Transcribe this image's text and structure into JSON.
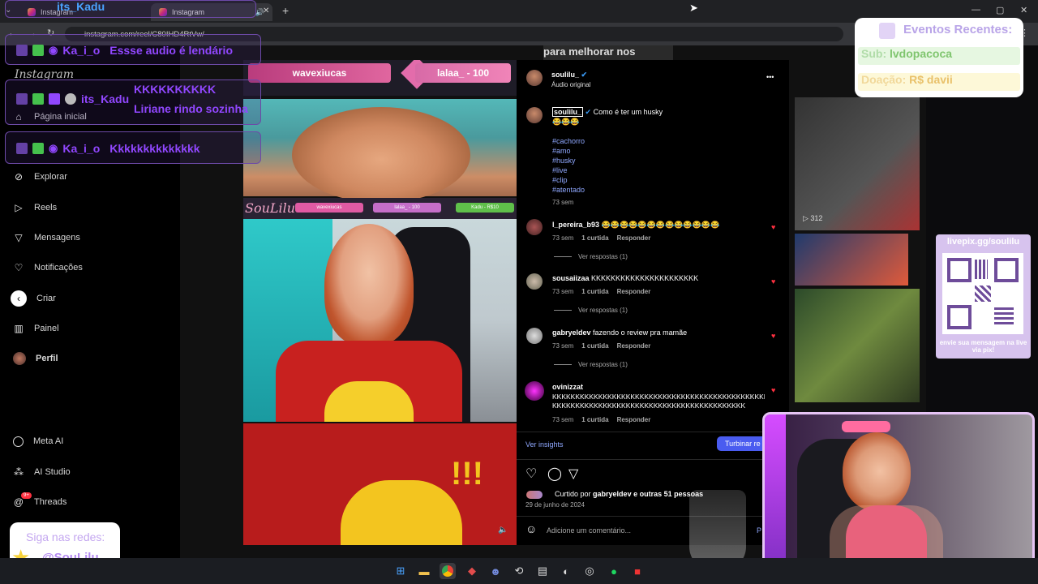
{
  "browser": {
    "tabs": [
      {
        "label": "Instagram"
      },
      {
        "label": "Instagram"
      }
    ],
    "url": "instagram.com/reel/C80IHD4RtVw/",
    "new_tab": "+",
    "window_controls": [
      "—",
      "▢",
      "✕"
    ]
  },
  "sidebar": {
    "logo": "Instagram",
    "items": [
      {
        "label": "Página inicial",
        "icon": "home-icon"
      },
      {
        "label": "Explorar",
        "icon": "compass-icon"
      },
      {
        "label": "Reels",
        "icon": "reels-icon"
      },
      {
        "label": "Mensagens",
        "icon": "send-icon"
      },
      {
        "label": "Notificações",
        "icon": "heart-icon"
      },
      {
        "label": "Criar",
        "icon": "plus-icon"
      },
      {
        "label": "Painel",
        "icon": "chart-icon"
      },
      {
        "label": "Perfil",
        "icon": "avatar"
      },
      {
        "label": "Meta AI",
        "icon": "meta-ai-icon"
      },
      {
        "label": "AI Studio",
        "icon": "ai-studio-icon"
      },
      {
        "label": "Threads",
        "icon": "threads-icon"
      }
    ],
    "threads_badge": "9+"
  },
  "chat_overlay": [
    {
      "user": "its_Kadu",
      "message": ""
    },
    {
      "user": "Ka_i_o",
      "message": "Essse audio é lendário"
    },
    {
      "user": "its_Kadu",
      "message": "KKKKKKKKKK",
      "message2": "Liriane rindo sozinha"
    },
    {
      "user": "Ka_i_o",
      "message": "Kkkkkkkkkkkkkk"
    }
  ],
  "video": {
    "banner_left": "wavexiucas",
    "banner_right": "lalaa_ - 100",
    "bar_logo": "SouLilu",
    "bar_items": [
      "wavexiucas",
      "lalaa_ - 100",
      "Kadu - R$10"
    ]
  },
  "post": {
    "author": "soulilu_",
    "audio": "Áudio original",
    "caption_user": "soulilu_",
    "caption": "Como é ter um husky",
    "caption_emoji": "😂😂😂",
    "hashtags": [
      "#cachorro",
      "#amo",
      "#husky",
      "#live",
      "#clip",
      "#atentado"
    ],
    "caption_time": "73 sem",
    "more": "•••",
    "comments": [
      {
        "user": "l_pereira_b93",
        "text": "😂😂😂😂😂😂😂😂😂😂😂😂😂",
        "time": "73 sem",
        "likes": "1 curtida",
        "reply": "Responder",
        "view_replies": "Ver respostas (1)"
      },
      {
        "user": "sousaiizaa",
        "text": "KKKKKKKKKKKKKKKKKKKKKK",
        "time": "73 sem",
        "likes": "1 curtida",
        "reply": "Responder",
        "view_replies": "Ver respostas (1)"
      },
      {
        "user": "gabryeldev",
        "text": "fazendo o review pra mamãe",
        "time": "73 sem",
        "likes": "1 curtida",
        "reply": "Responder",
        "view_replies": "Ver respostas (1)"
      },
      {
        "user": "ovinizzat",
        "text": "KKKKKKKKKKKKKKKKKKKKKKKKKKKKKKKKKKKKKKKKKKKKKKKKKK",
        "text2": "KKKKKKKKKKKKKKKKKKKKKKKKKKKKKKKKKKKKKKKKKK",
        "time": "73 sem",
        "likes": "1 curtida",
        "reply": "Responder"
      }
    ],
    "insights": "Ver insights",
    "boost": "Turbinar re",
    "liked_prefix": "Curtido por",
    "liked_user": "gabryeldev",
    "liked_suffix": "e outras 51 pessoas",
    "date": "29 de junho de 2024",
    "add_comment": "Adicione um comentário...",
    "post_btn": "P"
  },
  "events": {
    "title": "Eventos Recentes:",
    "sub_label": "Sub:",
    "sub_value": "lvdopacoca",
    "donation_label": "Doação:",
    "donation_value": "R$ davii"
  },
  "livepix": {
    "title": "livepix.gg/soulilu",
    "caption": "envie sua mensagem na live via pix!"
  },
  "social": {
    "title": "Siga nas redes:",
    "handle": "@SouLilu"
  },
  "feed_overlay": {
    "text": "para melhorar nos",
    "views": "312"
  },
  "colors": {
    "twitch_purple": "#9147ff",
    "link_blue": "#8fa8ff",
    "boost_blue": "#4a5cf0",
    "heart_red": "#ff3040"
  }
}
